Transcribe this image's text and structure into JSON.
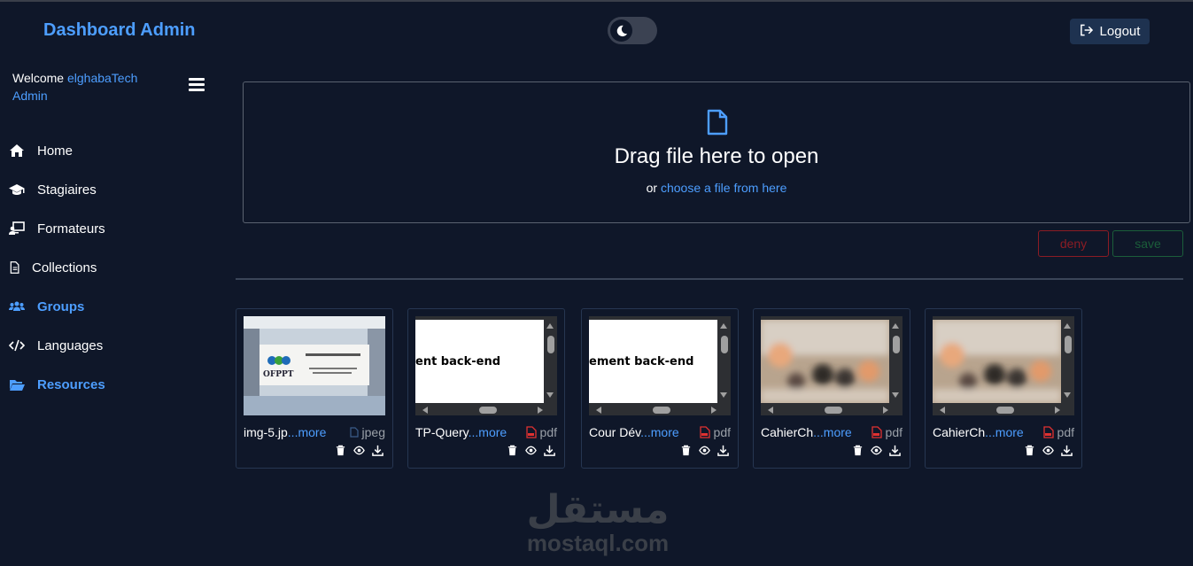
{
  "header": {
    "brand": "Dashboard Admin",
    "theme_toggle_icon": "moon-icon",
    "logout_label": "Logout"
  },
  "sidebar": {
    "welcome_prefix": "Welcome",
    "user_name": "elghabaTech Admin",
    "items": [
      {
        "label": "Home",
        "icon": "home-icon",
        "active": false
      },
      {
        "label": "Stagiaires",
        "icon": "graduation-cap-icon",
        "active": false
      },
      {
        "label": "Formateurs",
        "icon": "teacher-board-icon",
        "active": false
      },
      {
        "label": "Collections",
        "icon": "document-icon",
        "active": false
      },
      {
        "label": "Groups",
        "icon": "users-icon",
        "active": true
      },
      {
        "label": "Languages",
        "icon": "code-icon",
        "active": false
      },
      {
        "label": "Resources",
        "icon": "folder-open-icon",
        "active": true
      }
    ]
  },
  "dropzone": {
    "title": "Drag file here to open",
    "or_text": "or",
    "link_text": "choose a file from here"
  },
  "actions": {
    "deny_label": "deny",
    "save_label": "save"
  },
  "files": [
    {
      "name": "img-5.jp",
      "more": "...more",
      "type": "jpeg",
      "preview_kind": "image",
      "preview_text": "OFPPT"
    },
    {
      "name": "TP-Query",
      "more": "...more",
      "type": "pdf",
      "preview_kind": "pdf",
      "preview_text": "ent back-end"
    },
    {
      "name": "Cour Dév",
      "more": "...more",
      "type": "pdf",
      "preview_kind": "pdf",
      "preview_text": "ement back-end"
    },
    {
      "name": "CahierCh",
      "more": "...more",
      "type": "pdf",
      "preview_kind": "pdf-blur",
      "preview_text": ""
    },
    {
      "name": "CahierCh",
      "more": "...more",
      "type": "pdf",
      "preview_kind": "pdf-blur",
      "preview_text": ""
    }
  ],
  "watermark": {
    "text": "mostaql.com",
    "arabic": "مستقل"
  },
  "colors": {
    "background": "#0f1729",
    "accent": "#4d9eff",
    "deny": "#8b1c24",
    "save": "#1b5e3a"
  }
}
